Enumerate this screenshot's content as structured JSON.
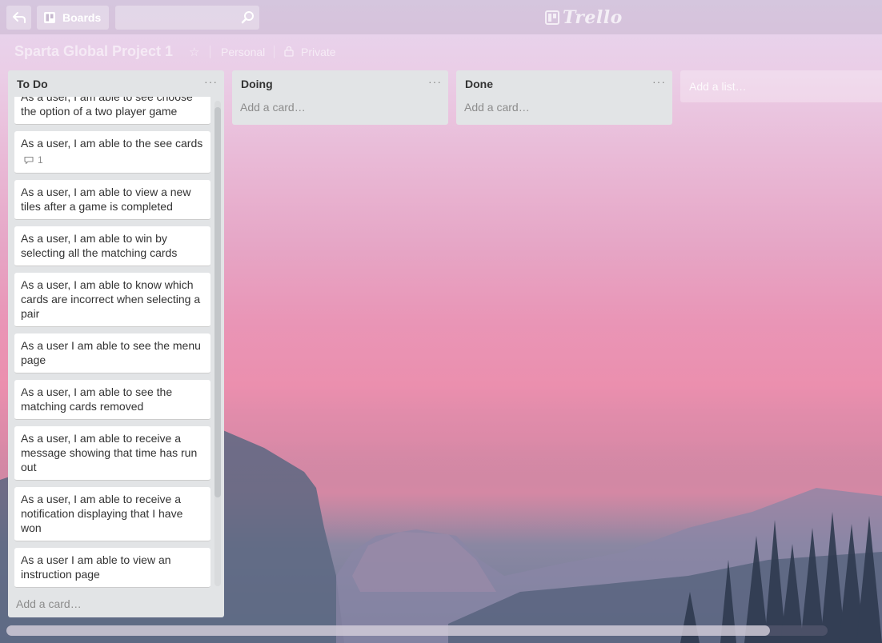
{
  "header": {
    "boards_label": "Boards",
    "search_placeholder": "",
    "logo_text": "Trello"
  },
  "board": {
    "title": "Sparta Global Project 1",
    "team": "Personal",
    "visibility": "Private"
  },
  "lists": {
    "todo": {
      "title": "To Do",
      "menu": "···",
      "cards": [
        {
          "text": "As a user, I am able to see choose the option of a two player game"
        },
        {
          "text": "As a user, I am able to the see cards",
          "comments": "1"
        },
        {
          "text": "As a user, I am able to view a new tiles after a game is completed"
        },
        {
          "text": "As a user, I am able to win by selecting all the matching cards"
        },
        {
          "text": "As a user, I am able to know which cards are incorrect when selecting a pair"
        },
        {
          "text": "As a user I am able to see the menu page"
        },
        {
          "text": "As a user, I am able to see the matching cards removed"
        },
        {
          "text": "As a user, I am able to receive a message showing that time has run out"
        },
        {
          "text": "As a user, I am able to receive a notification displaying that I have won"
        },
        {
          "text": "As a user I am able to view an instruction page"
        }
      ],
      "add_card": "Add a card…"
    },
    "doing": {
      "title": "Doing",
      "menu": "···",
      "add_card": "Add a card…"
    },
    "done": {
      "title": "Done",
      "menu": "···",
      "add_card": "Add a card…"
    }
  },
  "add_list": "Add a list…",
  "icons": {
    "back": "back-arrow-icon",
    "boards": "boards-icon",
    "search": "search-icon",
    "star": "star-icon",
    "lock": "lock-icon",
    "comment": "comment-icon"
  },
  "colors": {
    "list_bg": "#e2e4e6",
    "card_bg": "#ffffff",
    "muted_text": "#8c8c8c"
  }
}
